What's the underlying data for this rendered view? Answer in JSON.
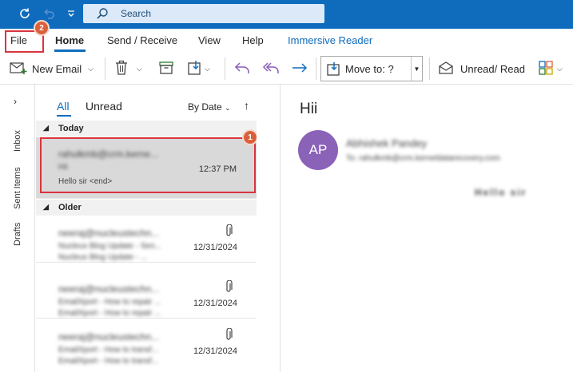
{
  "titlebar": {
    "search_placeholder": "Search"
  },
  "ribbon": {
    "tabs": [
      "File",
      "Home",
      "Send / Receive",
      "View",
      "Help",
      "Immersive Reader"
    ],
    "active_tab": "Home"
  },
  "toolbar": {
    "new_email": "New Email",
    "move_to": "Move to: ?",
    "unread_read": "Unread/ Read"
  },
  "rail": {
    "items": [
      "Inbox",
      "Sent Items",
      "Drafts"
    ]
  },
  "list": {
    "filters": {
      "all": "All",
      "unread": "Unread"
    },
    "sort": "By Date",
    "groups": {
      "today": "Today",
      "older": "Older"
    },
    "messages": [
      {
        "from": "rahulkmb@crm.kerne...",
        "subject": "Hii",
        "preview": "Hello sir  <end>",
        "date": "12:37 PM",
        "attachment": false,
        "selected": true
      },
      {
        "from": "neeraj@nucleustechn...",
        "subject": "Nucleus Blog Update - Sen...",
        "preview": "Nucleus Blog Update - ...",
        "date": "12/31/2024",
        "attachment": true
      },
      {
        "from": "neeraj@nucleustechn...",
        "subject": "EmailXport - How to repair ...",
        "preview": "EmailXport - How to repair ...",
        "date": "12/31/2024",
        "attachment": true
      },
      {
        "from": "neeraj@nucleustechn...",
        "subject": "EmailXport - How to transf...",
        "preview": "EmailXport - How to transf...",
        "date": "12/31/2024",
        "attachment": true
      }
    ]
  },
  "reading": {
    "subject": "Hii",
    "avatar_initials": "AP",
    "sender": "Abhishek Pandey",
    "to": "To:  rahulkmb@crm.kerneldatarecovery.com",
    "body": "Hello sir"
  },
  "annotations": {
    "step1": "1",
    "step2": "2"
  },
  "colors": {
    "titlebar": "#0f6cbd",
    "accent": "#0f6cbd",
    "highlight_box": "#d9343f",
    "badge": "#d9603b",
    "avatar": "#8a62b8"
  }
}
